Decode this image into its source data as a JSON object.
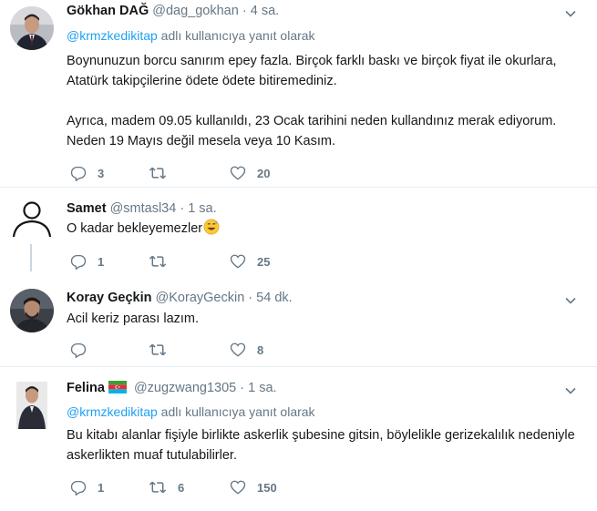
{
  "tweets": [
    {
      "name": "Gökhan DAĞ",
      "handle": "@dag_gokhan",
      "time": "4 sa.",
      "reply_prefix": "",
      "reply_to": "@krmzkedikitap",
      "reply_suffix": " adlı kullanıcıya yanıt olarak",
      "paragraphs": [
        "Boynunuzun borcu sanırım epey fazla. Birçok farklı baskı ve birçok fiyat ile okurlara, Atatürk takipçilerine ödete ödete bitiremediniz.",
        "Ayrıca, madem 09.05 kullanıldı, 23 Ocak tarihini neden kullandınız merak ediyorum. Neden 19 Mayıs değil mesela veya 10 Kasım."
      ],
      "replies": "3",
      "retweets": "",
      "likes": "20"
    },
    {
      "name": "Samet",
      "handle": "@smtasl34",
      "time": "1 sa.",
      "text": "O kadar bekleyemezler",
      "emoji_icon": "grinning-sweat-emoji",
      "replies": "1",
      "retweets": "",
      "likes": "25"
    },
    {
      "name": "Koray Geçkin",
      "handle": "@KorayGeckin",
      "time": "54 dk.",
      "text": "Acil keriz parası lazım.",
      "replies": "",
      "retweets": "",
      "likes": "8"
    },
    {
      "name": "Felina",
      "flag_icon": "azerbaijan-flag-icon",
      "handle": "@zugzwang1305",
      "time": "1 sa.",
      "reply_to": "@krmzkedikitap",
      "reply_suffix": " adlı kullanıcıya yanıt olarak",
      "paragraphs": [
        "Bu kitabı alanlar fişiyle birlikte askerlik şubesine gitsin, böylelikle gerizekalılık nedeniyle askerlikten muaf tutulabilirler."
      ],
      "replies": "1",
      "retweets": "6",
      "likes": "150"
    }
  ],
  "separator": "·",
  "colors": {
    "secondary": "#657786",
    "link": "#1da1f2",
    "divider": "#e6ecf0",
    "thread": "#ccd6dd"
  }
}
